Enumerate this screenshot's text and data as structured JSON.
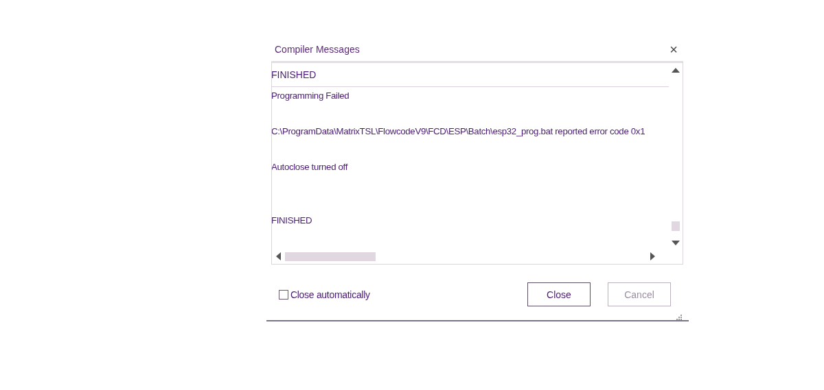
{
  "window": {
    "title": "Compiler Messages",
    "close": "×"
  },
  "output": {
    "header": "FINISHED",
    "lines": [
      {
        "kind": "text",
        "text": "Programming Failed"
      },
      {
        "kind": "blank"
      },
      {
        "kind": "text",
        "text": "C:\\ProgramData\\MatrixTSL\\FlowcodeV9\\FCD\\ESP\\Batch\\esp32_prog.bat reported error code 0x1"
      },
      {
        "kind": "blank"
      },
      {
        "kind": "text",
        "text": "Autoclose turned off"
      },
      {
        "kind": "blank"
      },
      {
        "kind": "blank"
      },
      {
        "kind": "text",
        "text": "FINISHED"
      }
    ]
  },
  "close_automatically": {
    "label": "Close automatically",
    "checked": false
  },
  "buttons": [
    {
      "label": "Close",
      "disabled": false
    },
    {
      "label": "Cancel",
      "disabled": true
    }
  ]
}
